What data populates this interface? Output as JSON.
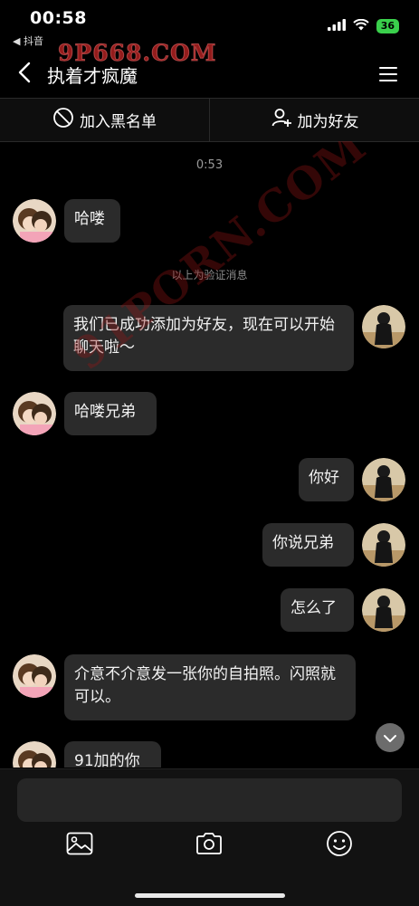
{
  "status": {
    "time": "00:58",
    "back_app": "◀ 抖音",
    "battery": "36"
  },
  "watermarks": {
    "top": "9P668.COM",
    "diagonal": "91PORN.COM"
  },
  "nav": {
    "title": "执着才疯魔"
  },
  "actions": {
    "block": "加入黑名单",
    "add_friend": "加为好友"
  },
  "chat": {
    "timestamp": "0:53",
    "system_message": "以上为验证消息",
    "messages": [
      {
        "side": "left",
        "text": "哈喽"
      },
      {
        "side": "right",
        "text": "我们已成功添加为好友，现在可以开始聊天啦～"
      },
      {
        "side": "left",
        "text": "哈喽兄弟"
      },
      {
        "side": "right",
        "text": "你好"
      },
      {
        "side": "right",
        "text": "你说兄弟"
      },
      {
        "side": "right",
        "text": "怎么了"
      },
      {
        "side": "left",
        "text": "介意不介意发一张你的自拍照。闪照就可以。"
      },
      {
        "side": "left",
        "text": "91加的你"
      }
    ]
  },
  "input": {
    "placeholder": ""
  },
  "colors": {
    "background": "#000000",
    "bubble": "#2b2b2b",
    "battery": "#3ad04c"
  },
  "icons": [
    "back-arrow-icon",
    "menu-icon",
    "block-icon",
    "add-user-icon",
    "image-icon",
    "camera-icon",
    "emoji-icon",
    "chevron-down-icon"
  ]
}
